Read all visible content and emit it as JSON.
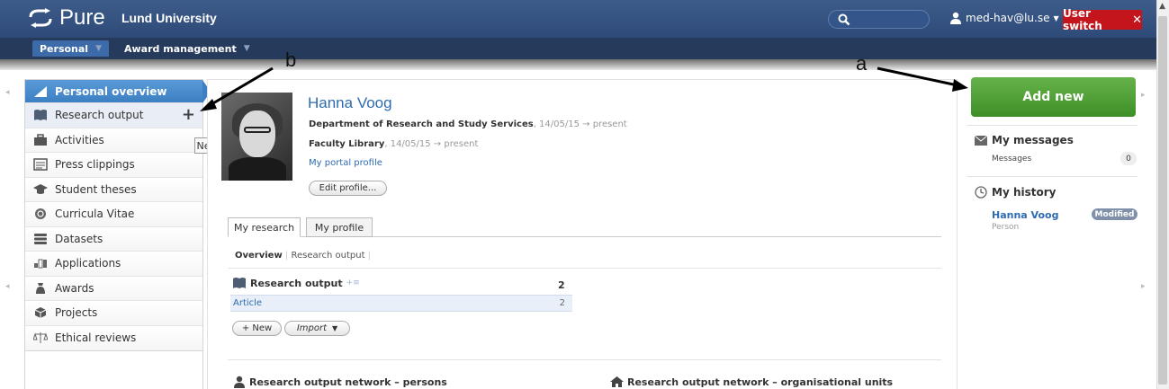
{
  "header": {
    "logo_text": "Pure",
    "org_name": "Lund University",
    "user_label": "med-hav@lu.se",
    "user_switch_label": "User switch"
  },
  "nav": {
    "tabs": [
      {
        "label": "Personal"
      },
      {
        "label": "Award management"
      }
    ]
  },
  "sidebar": {
    "items": [
      {
        "label": "Personal overview",
        "icon": "personal-overview-icon"
      },
      {
        "label": "Research output",
        "icon": "book-icon"
      },
      {
        "label": "Activities",
        "icon": "briefcase-icon"
      },
      {
        "label": "Press clippings",
        "icon": "newspaper-icon"
      },
      {
        "label": "Student theses",
        "icon": "graduation-cap-icon"
      },
      {
        "label": "Curricula Vitae",
        "icon": "cv-icon"
      },
      {
        "label": "Datasets",
        "icon": "database-icon"
      },
      {
        "label": "Applications",
        "icon": "applications-icon"
      },
      {
        "label": "Awards",
        "icon": "awards-icon"
      },
      {
        "label": "Projects",
        "icon": "projects-icon"
      },
      {
        "label": "Ethical reviews",
        "icon": "scales-icon"
      }
    ],
    "tooltip": "New"
  },
  "profile": {
    "name": "Hanna Voog",
    "affiliations": [
      {
        "unit": "Department of Research and Study Services",
        "date": ", 14/05/15 → present"
      },
      {
        "unit": "Faculty Library",
        "date": ", 14/05/15 → present"
      }
    ],
    "portal_link": "My portal profile",
    "edit_button": "Edit profile..."
  },
  "tabs": {
    "items": [
      "My research",
      "My profile"
    ]
  },
  "subnav": {
    "active": "Overview",
    "sep": "|",
    "other": "Research output",
    "trail": "|"
  },
  "research_output": {
    "title": "Research output",
    "extra": "+≡",
    "count": "2",
    "rows": [
      {
        "label": "Article",
        "count": "2"
      }
    ],
    "new_button": "+ New",
    "import_button": "Import"
  },
  "network": {
    "persons_title": "Research output network – persons",
    "units_title": "Research output network – organisational units"
  },
  "right_panel": {
    "add_new": "Add new",
    "messages_title": "My messages",
    "messages_label": "Messages",
    "messages_count": "0",
    "history_title": "My history",
    "history_item_name": "Hanna Voog",
    "history_item_type": "Person",
    "history_item_status": "Modified"
  },
  "annotations": {
    "a": "a",
    "b": "b"
  },
  "colors": {
    "header_bg": "#2d4a78",
    "accent_link": "#2e6bb0",
    "add_new_green": "#4a9d31",
    "user_switch_red": "#c4151c"
  }
}
